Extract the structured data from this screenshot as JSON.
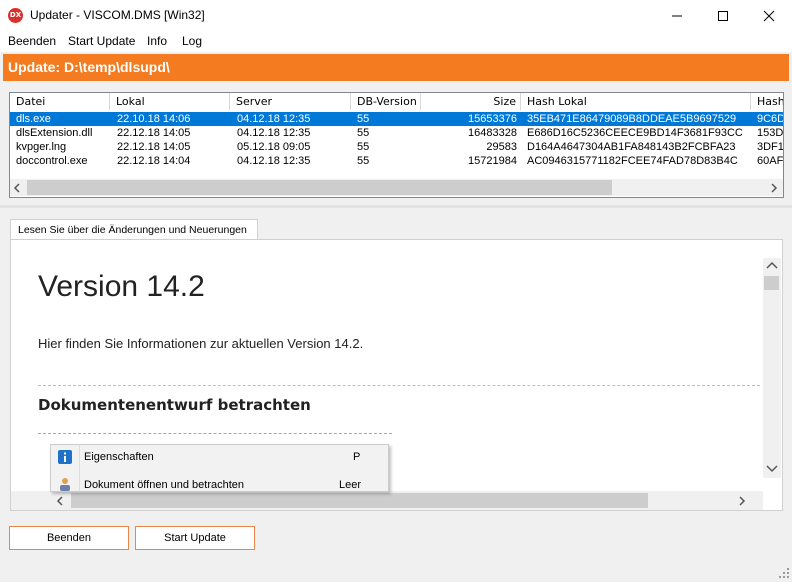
{
  "window": {
    "title": "Updater - VISCOM.DMS [Win32]",
    "logo_text": "DX"
  },
  "menu": [
    "Beenden",
    "Start Update",
    "Info",
    "Log"
  ],
  "banner": {
    "text": "Update: D:\\temp\\dlsupd\\",
    "color": "#f47b20"
  },
  "file_list": {
    "columns": [
      "Datei",
      "Lokal",
      "Server",
      "DB-Version",
      "Size",
      "Hash Lokal",
      "Hash"
    ],
    "rows": [
      {
        "file": "dls.exe",
        "local": "22.10.18 14:06",
        "server": "04.12.18 12:35",
        "db": "55",
        "size": "15653376",
        "hash_local": "35EB471E86479089B8DDEAE5B9697529",
        "hash": "9C6D",
        "selected": true
      },
      {
        "file": "dlsExtension.dll",
        "local": "22.12.18 14:05",
        "server": "04.12.18 12:35",
        "db": "55",
        "size": "16483328",
        "hash_local": "E686D16C5236CEECE9BD14F3681F93CC",
        "hash": "153D",
        "selected": false
      },
      {
        "file": "kvpger.lng",
        "local": "22.12.18 14:05",
        "server": "05.12.18 09:05",
        "db": "55",
        "size": "29583",
        "hash_local": "D164A4647304AB1FA848143B2FCBFA23",
        "hash": "3DF1",
        "selected": false
      },
      {
        "file": "doccontrol.exe",
        "local": "22.12.18 14:04",
        "server": "04.12.18 12:35",
        "db": "55",
        "size": "15721984",
        "hash_local": "AC0946315771182FCEE74FAD78D83B4C",
        "hash": "60AF",
        "selected": false
      }
    ]
  },
  "tab": {
    "label": "Lesen Sie über die Änderungen und Neuerungen"
  },
  "document": {
    "title": "Version 14.2",
    "intro": "Hier finden Sie Informationen zur aktuellen Version 14.2.",
    "heading": "Dokumentenentwurf betrachten"
  },
  "context_menu": [
    {
      "label": "Eigenschaften",
      "key": "P",
      "icon": "info-icon"
    },
    {
      "label": "Dokument öffnen und betrachten",
      "key": "Leer",
      "icon": "user-icon"
    }
  ],
  "buttons": {
    "quit": "Beenden",
    "start": "Start Update"
  },
  "colors": {
    "accent": "#f47b20",
    "selection": "#0078d7"
  }
}
